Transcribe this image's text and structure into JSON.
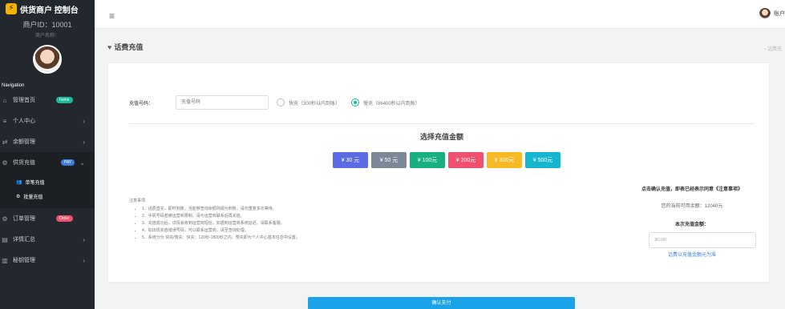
{
  "brand": {
    "title": "供货商户 控制台",
    "logo_icon": "lightning"
  },
  "merchant": {
    "id_text": "商户ID：10001",
    "name_text": "商户名称："
  },
  "nav": {
    "title": "Navigation",
    "items": [
      {
        "label": "管理首页",
        "icon": "home-icon",
        "badge": "home"
      },
      {
        "label": "个人中心",
        "icon": "list-icon"
      },
      {
        "label": "余额管理",
        "icon": "exchange-icon"
      },
      {
        "label": "供货充值",
        "icon": "gear-icon",
        "badge": "PAY"
      },
      {
        "label": "订单管理",
        "icon": "gear-icon",
        "badge": "Order"
      },
      {
        "label": "详情汇总",
        "icon": "doc-icon"
      },
      {
        "label": "秘钥管理",
        "icon": "book-icon"
      }
    ],
    "sub_items": [
      {
        "label": "单笔充值",
        "icon": "users-icon"
      },
      {
        "label": "批量充值",
        "icon": "gear-icon"
      }
    ]
  },
  "topbar": {
    "account_label": "账户"
  },
  "page": {
    "title": "话费充值",
    "breadcrumb": "话费充"
  },
  "form": {
    "phone_label": "充值号码：",
    "phone_placeholder": "充值号码",
    "options": [
      {
        "label": "快充（300秒以内到账）",
        "checked": false
      },
      {
        "label": "慢充（86400秒以内到账）",
        "checked": true
      }
    ]
  },
  "amounts": {
    "title": "选择充值金额",
    "items": [
      {
        "label": "¥ 30 元",
        "color": "#5b6be3"
      },
      {
        "label": "¥ 50 元",
        "color": "#7c8797"
      },
      {
        "label": "¥ 100元",
        "color": "#18b07e"
      },
      {
        "label": "¥ 200元",
        "color": "#f0506e"
      },
      {
        "label": "¥ 300元",
        "color": "#f7b924"
      },
      {
        "label": "¥ 500元",
        "color": "#16b5d0"
      }
    ]
  },
  "notes": {
    "title": "注意事项",
    "items": [
      "1、话费直充，即时到账，当能够查询余额则视为到账，请勿重复多次等待。",
      "2、手机号码若被运营商限制，请与运营商联系后再充值。",
      "3、充值成功后，详情会收到运营商短信，如遇到运营商系统延迟，请联系客服。",
      "4、如出现充值错误号码，可以联系运营商，请至查询处理。",
      "5、系统分为 快充/慢充：快充：120秒-1800秒之内，慢充即为个人中心基本信息中设置。"
    ]
  },
  "summary": {
    "confirm_text": "点击确认充值，即表已经表示同意《注意事项》",
    "balance_text": "您的当前可用余额：12040元",
    "amount_label": "本次充值金额：",
    "amount_value": "30.00",
    "hint": "话费以充值金额元为准"
  },
  "submit": {
    "label": "确认支付"
  }
}
